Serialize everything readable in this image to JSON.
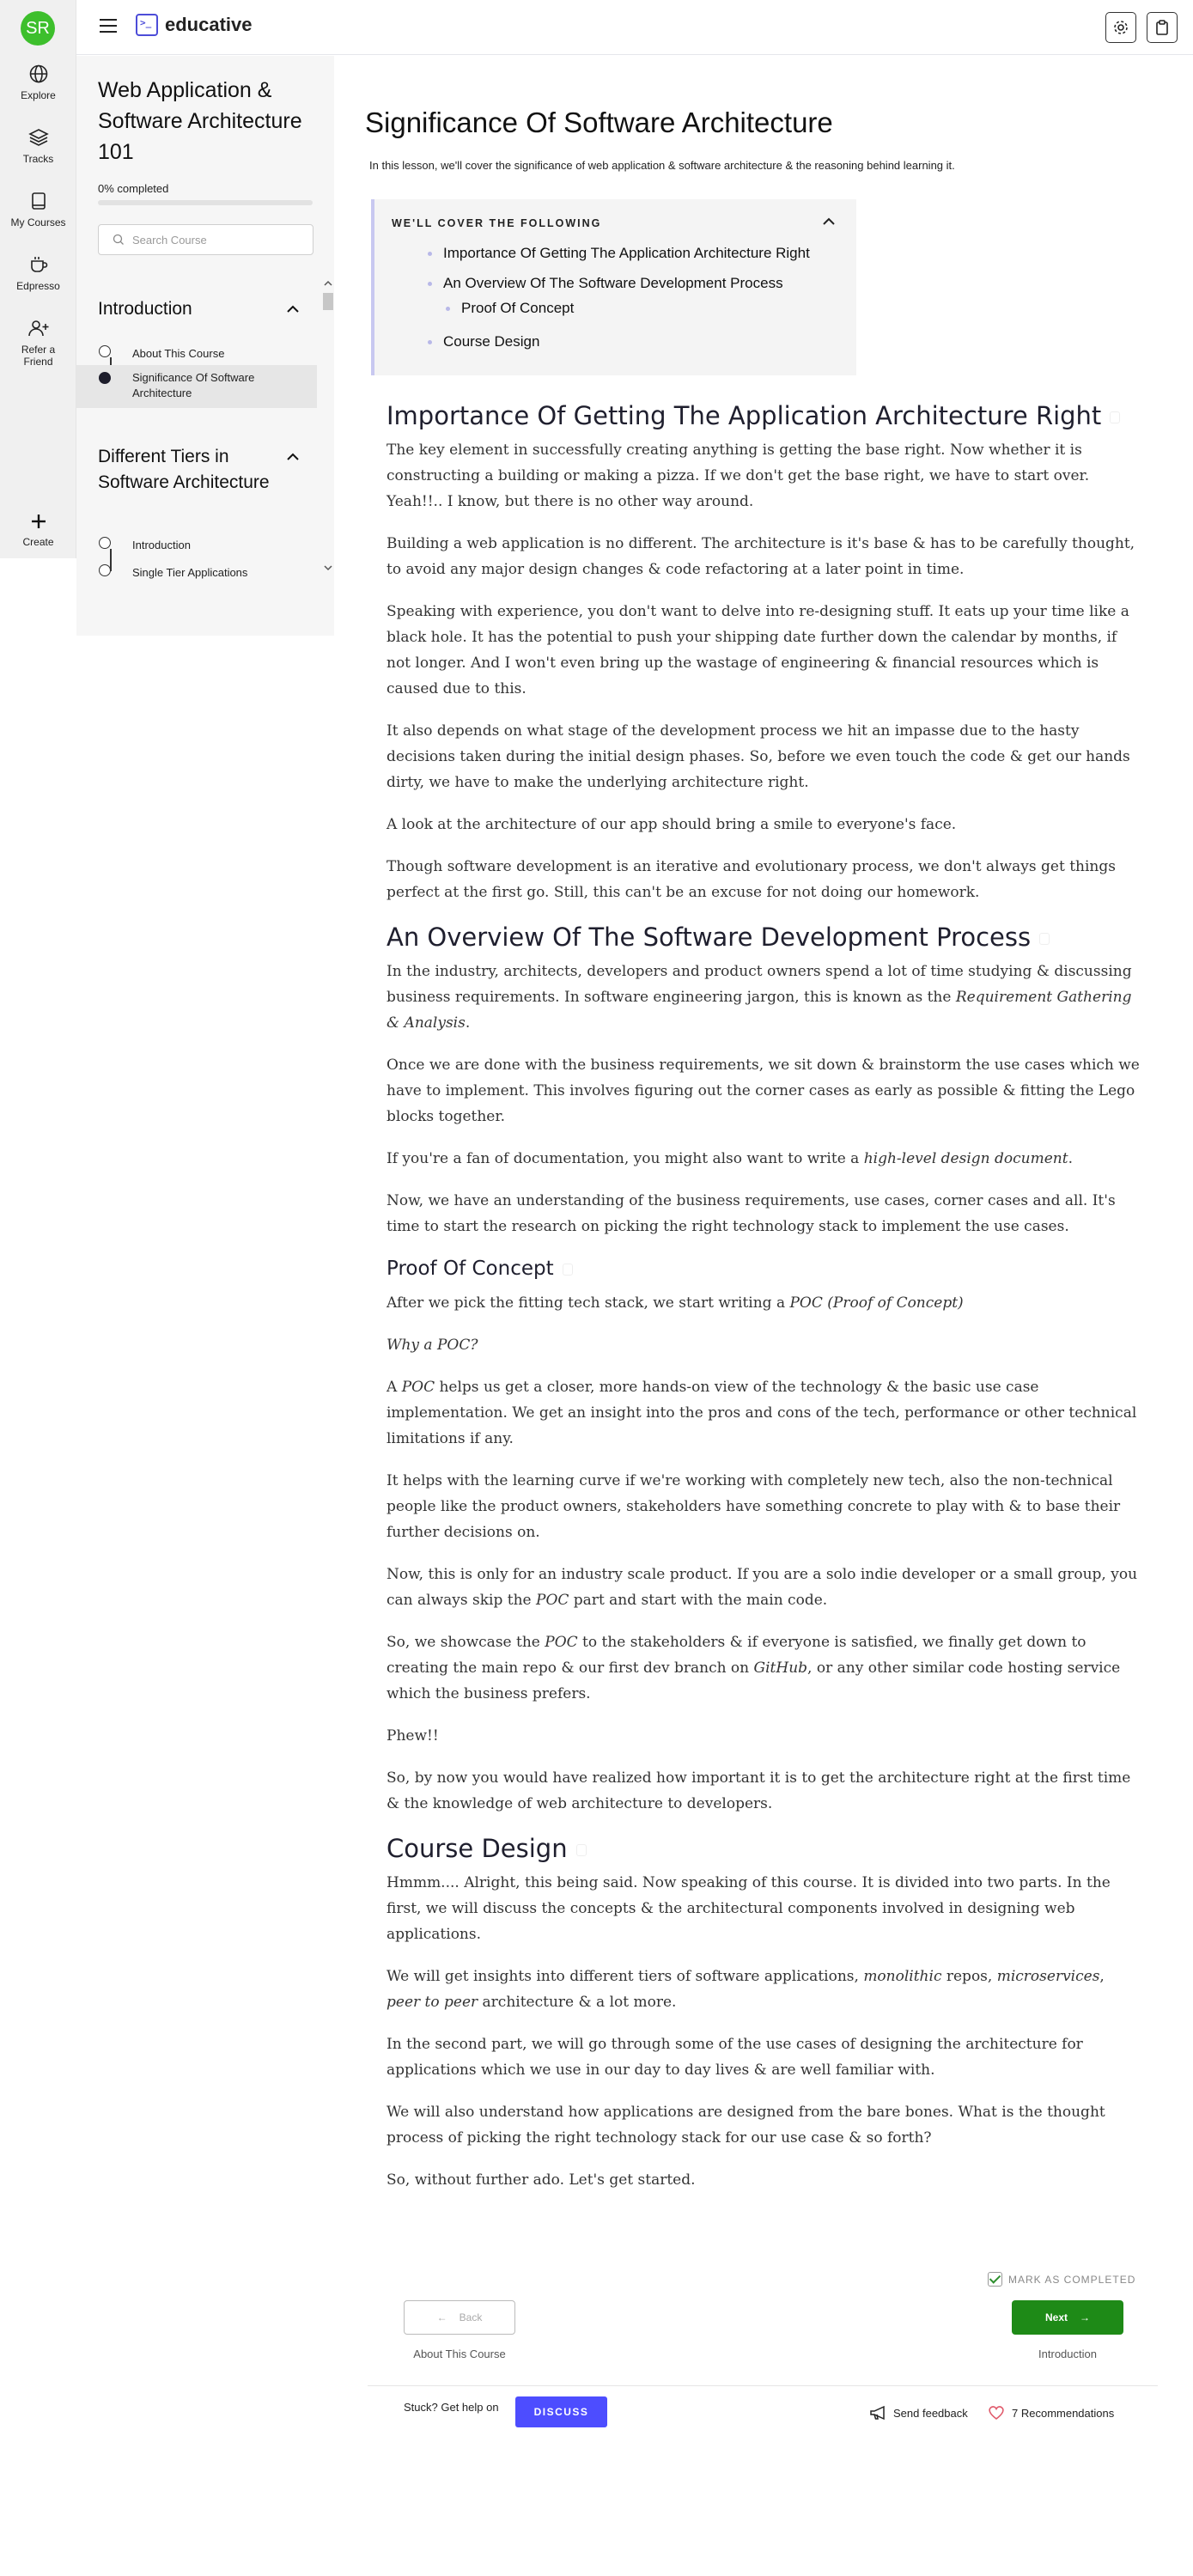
{
  "user": {
    "initials": "SR",
    "avatar_color": "#3dbf2c"
  },
  "rail": {
    "explore": "Explore",
    "tracks": "Tracks",
    "my_courses": "My Courses",
    "edpresso": "Edpresso",
    "refer_line1": "Refer a",
    "refer_line2": "Friend",
    "create": "Create"
  },
  "brand": {
    "name": "educative",
    "accent": "#4d4dd8"
  },
  "course": {
    "title": "Web Application & Software Architecture 101",
    "progress_text": "0% completed",
    "progress_fraction": 0.0,
    "search_placeholder": "Search Course",
    "sections": [
      {
        "title": "Introduction",
        "lessons": [
          "About This Course",
          "Significance Of Software Architecture"
        ]
      },
      {
        "title": "Different Tiers in Software Architecture",
        "lessons": [
          "Introduction",
          "Single Tier Applications"
        ]
      }
    ]
  },
  "lesson": {
    "title": "Significance Of Software Architecture",
    "intro": "In this lesson, we'll cover the significance of web application & software architecture & the reasoning behind learning it.",
    "toc_heading": "WE'LL COVER THE FOLLOWING",
    "toc": [
      "Importance Of Getting The Application Architecture Right",
      "An Overview Of The Software Development Process",
      "Proof Of Concept",
      "Course Design"
    ]
  },
  "article": {
    "h_importance": "Importance Of Getting The Application Architecture Right",
    "p1": "The key element in successfully creating anything is getting the base right. Now whether it is constructing a building or making a pizza. If we don't get the base right, we have to start over. Yeah!!.. I know, but there is no other way around.",
    "p2": "Building a web application is no different. The architecture is it's base & has to be carefully thought, to avoid any major design changes & code refactoring at a later point in time.",
    "p3": "Speaking with experience, you don't want to delve into re-designing stuff. It eats up your time like a black hole. It has the potential to push your shipping date further down the calendar by months, if not longer. And I won't even bring up the wastage of engineering & financial resources which is caused due to this.",
    "p4": "It also depends on what stage of the development process we hit an impasse due to the hasty decisions taken during the initial design phases. So, before we even touch the code & get our hands dirty, we have to make the underlying architecture right.",
    "p5": "A look at the architecture of our app should bring a smile to everyone's face.",
    "p6": "Though software development is an iterative and evolutionary process, we don't always get things perfect at the first go. Still, this can't be an excuse for not doing our homework.",
    "h_overview": "An Overview Of The Software Development Process",
    "p7a": "In the industry, architects, developers and product owners spend a lot of time studying & discussing business requirements. In software engineering jargon, this is known as the ",
    "p7b": "Requirement Gathering & Analysis",
    "p7c": ".",
    "p8": "Once we are done with the business requirements, we sit down & brainstorm the use cases which we have to implement. This involves figuring out the corner cases as early as possible & fitting the Lego blocks together.",
    "p9a": "If you're a fan of documentation, you might also want to write a ",
    "p9b": "high-level design document",
    "p9c": ".",
    "p10": "Now, we have an understanding of the business requirements, use cases, corner cases and all. It's time to start the research on picking the right technology stack to implement the use cases.",
    "h_poc": "Proof Of Concept",
    "p11a": "After we pick the fitting tech stack, we start writing a ",
    "p11b": "POC (Proof of Concept)",
    "p12": "Why a POC?",
    "p13a": "A ",
    "p13b": "POC",
    "p13c": " helps us get a closer, more hands-on view of the technology & the basic use case implementation. We get an insight into the pros and cons of the tech, performance or other technical limitations if any.",
    "p14": "It helps with the learning curve if we're working with completely new tech, also the non-technical people like the product owners, stakeholders have something concrete to play with & to base their further decisions on.",
    "p15a": "Now, this is only for an industry scale product. If you are a solo indie developer or a small group, you can always skip the ",
    "p15b": "POC",
    "p15c": " part and start with the main code.",
    "p16a": "So, we showcase the ",
    "p16b": "POC",
    "p16c": " to the stakeholders & if everyone is satisfied, we finally get down to creating the main repo & our first dev branch on ",
    "p16d": "GitHub",
    "p16e": ", or any other similar code hosting service which the business prefers.",
    "p17": "Phew!!",
    "p18": "So, by now you would have realized how important it is to get the architecture right at the first time & the knowledge of web architecture to developers.",
    "h_course": "Course Design",
    "p19": "Hmmm.... Alright, this being said. Now speaking of this course. It is divided into two parts. In the first, we will discuss the concepts & the architectural components involved in designing web applications.",
    "p20a": "We will get insights into different tiers of software applications, ",
    "p20b": "monolithic",
    "p20c": " repos, ",
    "p20d": "microservices",
    "p20e": ", ",
    "p20f": "peer to peer",
    "p20g": " architecture & a lot more.",
    "p21": "In the second part, we will go through some of the use cases of designing the architecture for applications which we use in our day to day lives & are well familiar with.",
    "p22": "We will also understand how applications are designed from the bare bones. What is the thought process of picking the right technology stack for our use case & so forth?",
    "p23": "So, without further ado. Let's get started."
  },
  "footer": {
    "mark_completed": "MARK AS COMPLETED",
    "back_label": "Back",
    "back_sub": "About This Course",
    "next_label": "Next",
    "next_sub": "Introduction",
    "stuck": "Stuck? Get help on",
    "discuss": "DISCUSS",
    "send_feedback": "Send feedback",
    "recommendations": "7 Recommendations"
  }
}
